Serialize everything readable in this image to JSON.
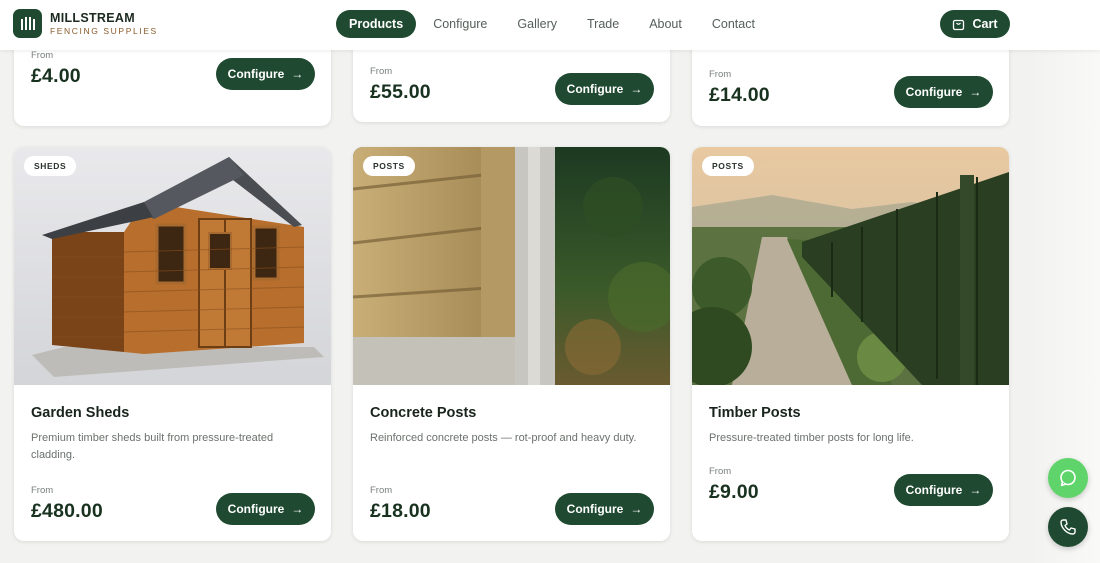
{
  "brand": {
    "name": "MILLSTREAM",
    "tagline": "FENCING SUPPLIES"
  },
  "nav": {
    "items": [
      {
        "label": "Products",
        "active": true
      },
      {
        "label": "Configure",
        "active": false
      },
      {
        "label": "Gallery",
        "active": false
      },
      {
        "label": "Trade",
        "active": false
      },
      {
        "label": "About",
        "active": false
      },
      {
        "label": "Contact",
        "active": false
      }
    ],
    "cart_label": "Cart"
  },
  "products_top": [
    {
      "from_label": "From",
      "price": "£4.00",
      "button": "Configure"
    },
    {
      "from_label": "From",
      "price": "£55.00",
      "button": "Configure"
    },
    {
      "from_label": "From",
      "price": "£14.00",
      "button": "Configure"
    }
  ],
  "products": [
    {
      "badge": "SHEDS",
      "title": "Garden Sheds",
      "description": "Premium timber sheds built from pressure-treated cladding.",
      "from_label": "From",
      "price": "£480.00",
      "button": "Configure"
    },
    {
      "badge": "POSTS",
      "title": "Concrete Posts",
      "description": "Reinforced concrete posts — rot-proof and heavy duty.",
      "from_label": "From",
      "price": "£18.00",
      "button": "Configure"
    },
    {
      "badge": "POSTS",
      "title": "Timber Posts",
      "description": "Pressure-treated timber posts for long life.",
      "from_label": "From",
      "price": "£9.00",
      "button": "Configure"
    }
  ],
  "colors": {
    "primary": "#1f4a31",
    "accent": "#8a5a2a",
    "whatsapp": "#5fd46a"
  },
  "icons": {
    "logo": "fence-icon",
    "cart": "cart-icon",
    "arrow": "arrow-right-icon",
    "chat": "whatsapp-icon",
    "phone": "phone-icon"
  }
}
